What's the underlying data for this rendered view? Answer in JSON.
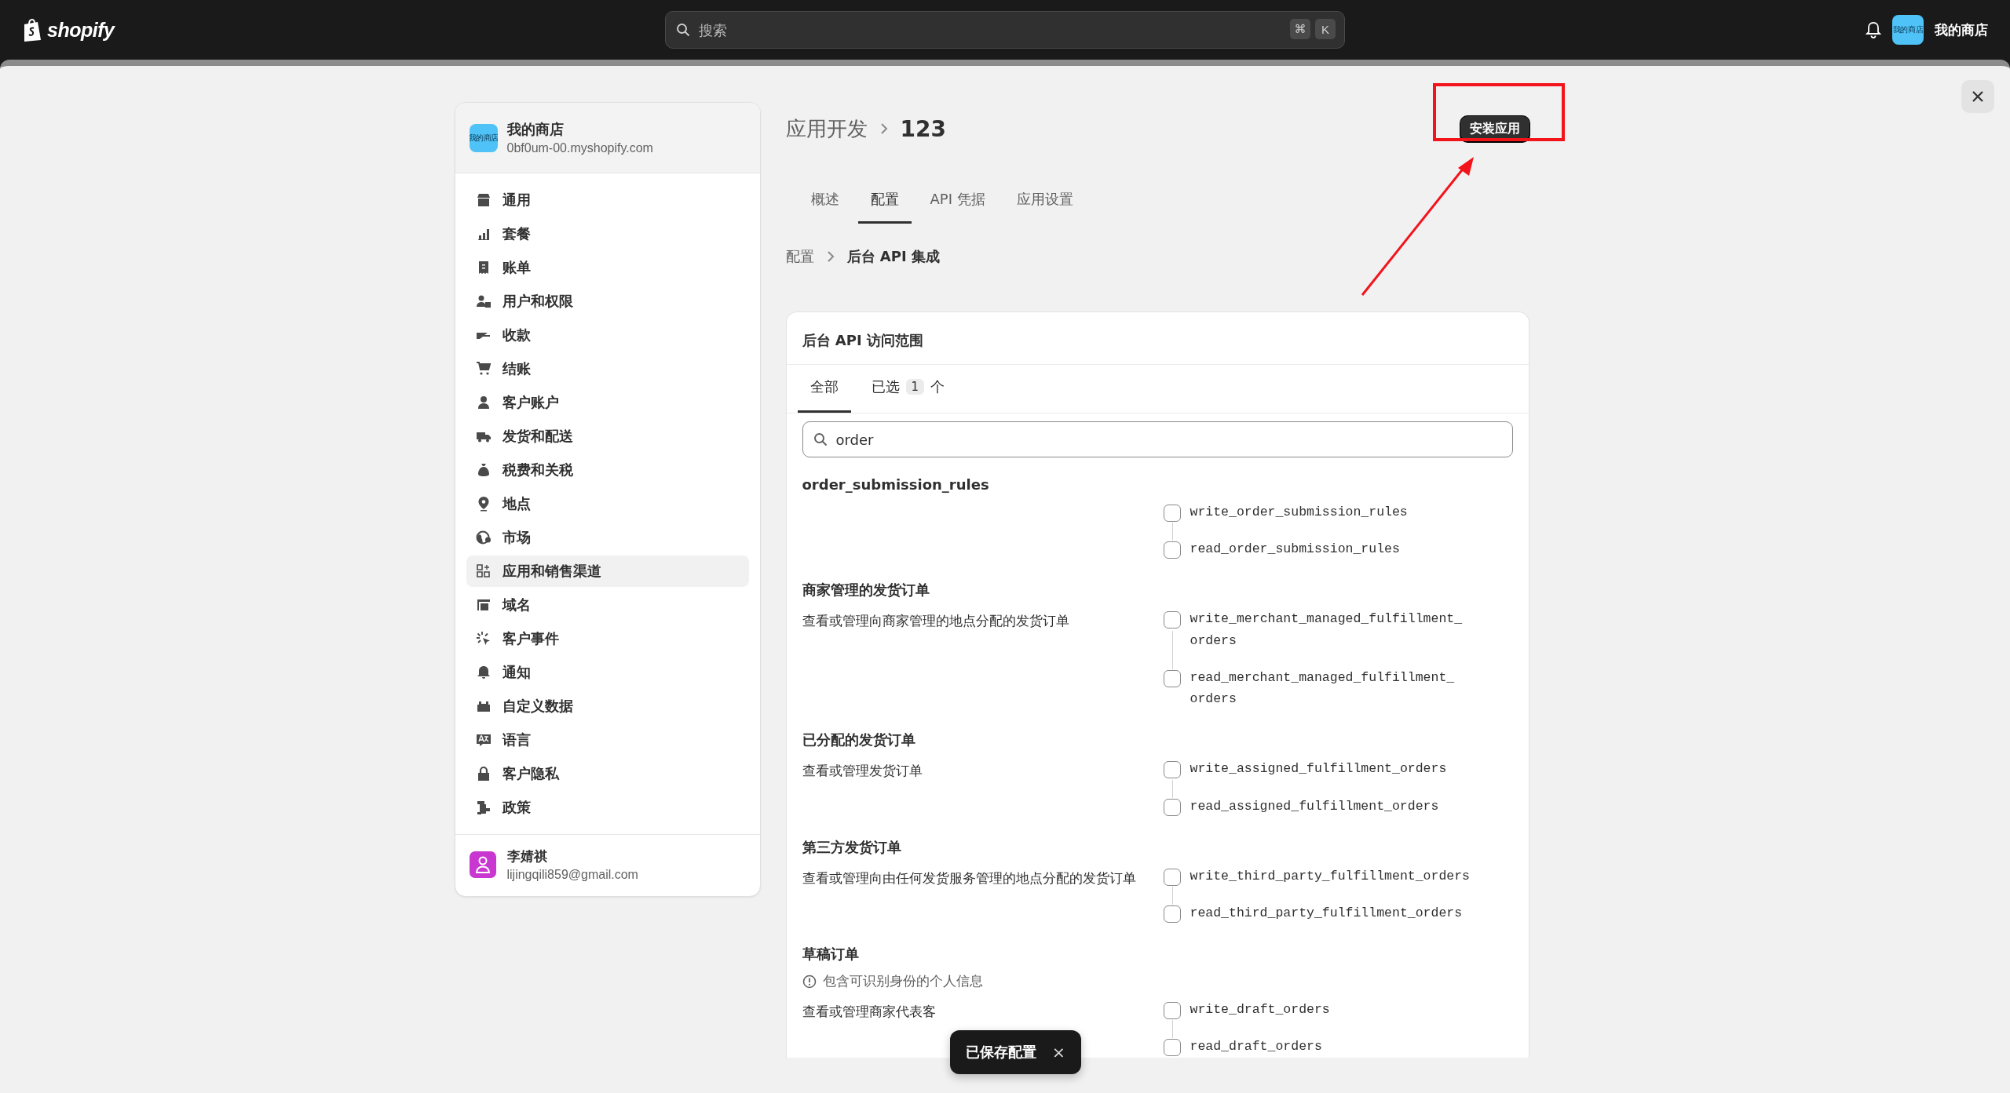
{
  "topbar": {
    "logo": "shopify",
    "search": {
      "placeholder": "搜索",
      "keys": [
        "⌘",
        "K"
      ]
    },
    "store_avatar": "我的商店",
    "store_name": "我的商店"
  },
  "sidebar": {
    "store": {
      "avatar": "我的商店",
      "name": "我的商店",
      "domain": "0bf0um-00.myshopify.com"
    },
    "items": [
      {
        "label": "通用",
        "selected": false
      },
      {
        "label": "套餐",
        "selected": false
      },
      {
        "label": "账单",
        "selected": false
      },
      {
        "label": "用户和权限",
        "selected": false
      },
      {
        "label": "收款",
        "selected": false
      },
      {
        "label": "结账",
        "selected": false
      },
      {
        "label": "客户账户",
        "selected": false
      },
      {
        "label": "发货和配送",
        "selected": false
      },
      {
        "label": "税费和关税",
        "selected": false
      },
      {
        "label": "地点",
        "selected": false
      },
      {
        "label": "市场",
        "selected": false
      },
      {
        "label": "应用和销售渠道",
        "selected": true
      },
      {
        "label": "域名",
        "selected": false
      },
      {
        "label": "客户事件",
        "selected": false
      },
      {
        "label": "通知",
        "selected": false
      },
      {
        "label": "自定义数据",
        "selected": false
      },
      {
        "label": "语言",
        "selected": false
      },
      {
        "label": "客户隐私",
        "selected": false
      },
      {
        "label": "政策",
        "selected": false
      }
    ],
    "user": {
      "name": "李婧祺",
      "email": "lijingqili859@gmail.com"
    }
  },
  "header": {
    "breadcrumb": "应用开发",
    "title": "123",
    "install_button": "安装应用"
  },
  "tabs": [
    {
      "label": "概述",
      "selected": false
    },
    {
      "label": "配置",
      "selected": true
    },
    {
      "label": "API 凭据",
      "selected": false
    },
    {
      "label": "应用设置",
      "selected": false
    }
  ],
  "sub_breadcrumb": {
    "parent": "配置",
    "current": "后台 API 集成"
  },
  "scopes_card": {
    "title": "后台 API 访问范围",
    "tabs": [
      {
        "label": "全部",
        "selected": true
      },
      {
        "label": "已选",
        "count": "1",
        "suffix": "个",
        "selected": false
      }
    ],
    "search": {
      "value": "order"
    },
    "groups": [
      {
        "title": "order_submission_rules",
        "scopes": [
          {
            "name": "write_order_submission_rules",
            "checked": false
          },
          {
            "name": "read_order_submission_rules",
            "checked": false
          }
        ]
      },
      {
        "title": "商家管理的发货订单",
        "description": "查看或管理向商家管理的地点分配的发货订单",
        "scopes": [
          {
            "name": "write_merchant_managed_fulfillment_orders",
            "checked": false
          },
          {
            "name": "read_merchant_managed_fulfillment_orders",
            "checked": false
          }
        ]
      },
      {
        "title": "已分配的发货订单",
        "description": "查看或管理发货订单",
        "scopes": [
          {
            "name": "write_assigned_fulfillment_orders",
            "checked": false
          },
          {
            "name": "read_assigned_fulfillment_orders",
            "checked": false
          }
        ]
      },
      {
        "title": "第三方发货订单",
        "description": "查看或管理向由任何发货服务管理的地点分配的发货订单",
        "scopes": [
          {
            "name": "write_third_party_fulfillment_orders",
            "checked": false
          },
          {
            "name": "read_third_party_fulfillment_orders",
            "checked": false
          }
        ]
      },
      {
        "title": "草稿订单",
        "note": "包含可识别身份的个人信息",
        "description": "查看或管理商家代表客",
        "scopes": [
          {
            "name": "write_draft_orders",
            "checked": false
          },
          {
            "name": "read_draft_orders",
            "checked": false
          }
        ]
      }
    ]
  },
  "toast": {
    "text": "已保存配置",
    "close": "×"
  }
}
